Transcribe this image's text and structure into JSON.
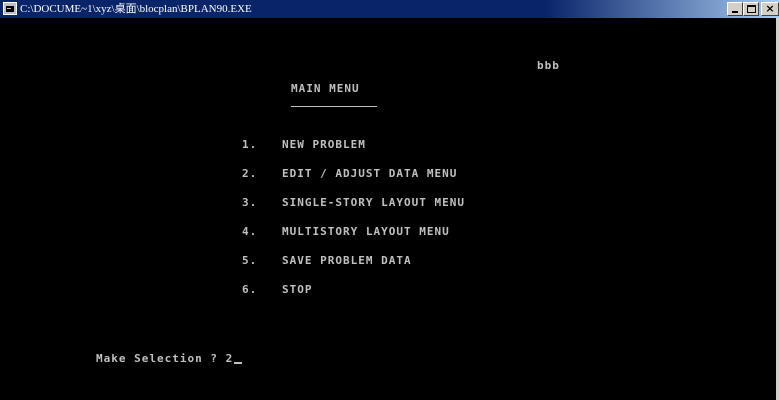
{
  "window": {
    "title": "C:\\DOCUME~1\\xyz\\桌面\\blocplan\\BPLAN90.EXE",
    "icon": "console-icon",
    "controls": {
      "minimize": "minimize-icon",
      "maximize": "maximize-icon",
      "close_label": "×"
    }
  },
  "console": {
    "user_label": "bbb",
    "menu_title": "MAIN MENU",
    "items": [
      {
        "number": "1.",
        "label": "NEW PROBLEM"
      },
      {
        "number": "2.",
        "label": "EDIT / ADJUST DATA MENU"
      },
      {
        "number": "3.",
        "label": "SINGLE-STORY LAYOUT MENU"
      },
      {
        "number": "4.",
        "label": "MULTISTORY LAYOUT MENU"
      },
      {
        "number": "5.",
        "label": "SAVE PROBLEM DATA"
      },
      {
        "number": "6.",
        "label": "STOP"
      }
    ],
    "prompt": "Make Selection ?",
    "input_value": "2"
  },
  "colors": {
    "titlebar": "#0a246a",
    "text": "#c0c0c0",
    "background": "#000000"
  }
}
